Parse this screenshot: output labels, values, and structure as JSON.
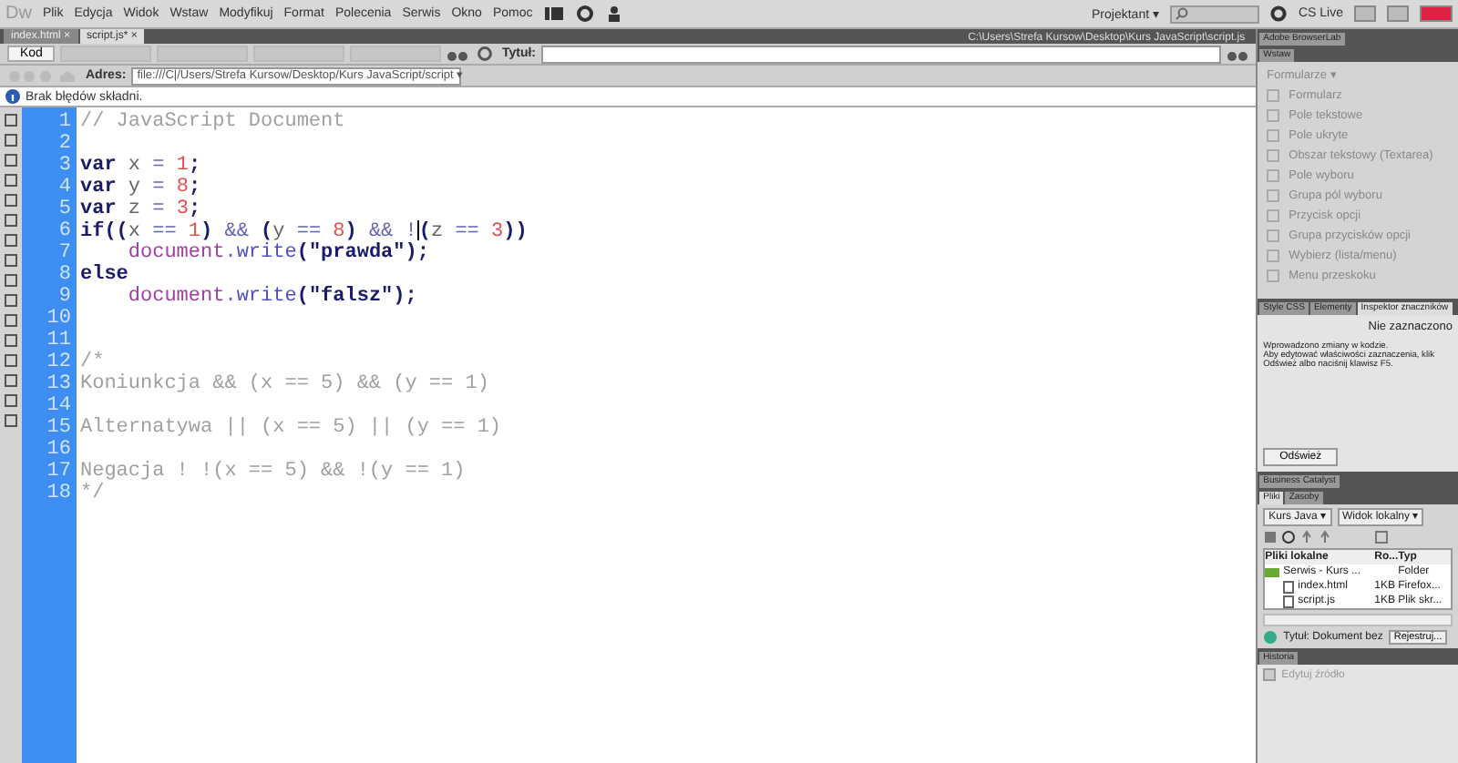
{
  "menu_bar": {
    "logo": "Dw",
    "items": [
      "Plik",
      "Edycja",
      "Widok",
      "Wstaw",
      "Modyfikuj",
      "Format",
      "Polecenia",
      "Serwis",
      "Okno",
      "Pomoc"
    ],
    "workspace": "Projektant ▾",
    "cs_live": "CS Live"
  },
  "document_tabs": [
    {
      "label": "index.html",
      "close": "×",
      "selected": false
    },
    {
      "label": "script.js*",
      "close": "×",
      "selected": true
    }
  ],
  "document_path": "C:\\Users\\Strefa Kursow\\Desktop\\Kurs JavaScript\\script.js",
  "toolbar": {
    "view_buttons": [
      {
        "label": "Kod",
        "selected": true
      }
    ],
    "title_label": "Tytuł:"
  },
  "address_bar": {
    "label": "Adres:",
    "value": "file:///C|/Users/Strefa Kursow/Desktop/Kurs JavaScript/script",
    "arrow": "▾"
  },
  "info_bar": {
    "message": "Brak błędów składni."
  },
  "editor": {
    "lines": [
      {
        "number": "1",
        "tokens": [
          {
            "kind": "comment",
            "text": "// JavaScript Document"
          }
        ]
      },
      {
        "number": "2"
      },
      {
        "number": "3",
        "tokens": [
          {
            "kind": "keyword",
            "text": "var"
          },
          {
            "kind": "ident",
            "text": " x "
          },
          {
            "kind": "op",
            "text": "="
          },
          {
            "kind": "number",
            "text": " 1"
          },
          {
            "kind": "punct",
            "text": ";"
          }
        ]
      },
      {
        "number": "4",
        "tokens": [
          {
            "kind": "keyword",
            "text": "var"
          },
          {
            "kind": "ident",
            "text": " y "
          },
          {
            "kind": "op",
            "text": "="
          },
          {
            "kind": "number",
            "text": " 8"
          },
          {
            "kind": "punct",
            "text": ";"
          }
        ]
      },
      {
        "number": "5",
        "tokens": [
          {
            "kind": "keyword",
            "text": "var"
          },
          {
            "kind": "ident",
            "text": " z "
          },
          {
            "kind": "op",
            "text": "="
          },
          {
            "kind": "number",
            "text": " 3"
          },
          {
            "kind": "punct",
            "text": ";"
          }
        ]
      },
      {
        "number": "6",
        "tokens": [
          {
            "kind": "keyword",
            "text": "if"
          },
          {
            "kind": "punct",
            "text": "(("
          },
          {
            "kind": "ident",
            "text": "x "
          },
          {
            "kind": "op",
            "text": "=="
          },
          {
            "kind": "number",
            "text": " 1"
          },
          {
            "kind": "punct",
            "text": ")"
          },
          {
            "kind": "op",
            "text": " && "
          },
          {
            "kind": "punct",
            "text": "("
          },
          {
            "kind": "ident",
            "text": "y "
          },
          {
            "kind": "op",
            "text": "=="
          },
          {
            "kind": "number",
            "text": " 8"
          },
          {
            "kind": "punct",
            "text": ")"
          },
          {
            "kind": "op",
            "text": " && !"
          },
          {
            "kind": "caret"
          },
          {
            "kind": "punct",
            "text": "("
          },
          {
            "kind": "ident",
            "text": "z "
          },
          {
            "kind": "op",
            "text": "=="
          },
          {
            "kind": "number",
            "text": " 3"
          },
          {
            "kind": "punct",
            "text": "))"
          }
        ]
      },
      {
        "number": "7",
        "tokens": [
          {
            "kind": "object",
            "text": "    document"
          },
          {
            "kind": "op",
            "text": "."
          },
          {
            "kind": "method",
            "text": "write"
          },
          {
            "kind": "punct",
            "text": "("
          },
          {
            "kind": "string",
            "text": "\"prawda\""
          },
          {
            "kind": "punct",
            "text": ");"
          }
        ]
      },
      {
        "number": "8",
        "tokens": [
          {
            "kind": "keyword",
            "text": "else"
          }
        ]
      },
      {
        "number": "9",
        "tokens": [
          {
            "kind": "object",
            "text": "    document"
          },
          {
            "kind": "op",
            "text": "."
          },
          {
            "kind": "method",
            "text": "write"
          },
          {
            "kind": "punct",
            "text": "("
          },
          {
            "kind": "string",
            "text": "\"falsz\""
          },
          {
            "kind": "punct",
            "text": ");"
          }
        ]
      },
      {
        "number": "10"
      },
      {
        "number": "11"
      },
      {
        "number": "12",
        "tokens": [
          {
            "kind": "comment",
            "text": "/*"
          }
        ]
      },
      {
        "number": "13",
        "tokens": [
          {
            "kind": "comment",
            "text": "Koniunkcja && (x == 5) && (y == 1)"
          }
        ]
      },
      {
        "number": "14"
      },
      {
        "number": "15",
        "tokens": [
          {
            "kind": "comment",
            "text": "Alternatywa || (x == 5) || (y == 1)"
          }
        ]
      },
      {
        "number": "16"
      },
      {
        "number": "17",
        "tokens": [
          {
            "kind": "comment",
            "text": "Negacja ! !(x == 5) && !(y == 1)"
          }
        ]
      },
      {
        "number": "18",
        "tokens": [
          {
            "kind": "comment",
            "text": "*/"
          }
        ]
      }
    ]
  },
  "panels": {
    "browserlab": {
      "title": "Adobe BrowserLab"
    },
    "insert": {
      "tab": "Wstaw",
      "category": "Formularze",
      "category_arrow": "▾",
      "items": [
        "Formularz",
        "Pole tekstowe",
        "Pole ukryte",
        "Obszar tekstowy (Textarea)",
        "Pole wyboru",
        "Grupa pól wyboru",
        "Przycisk opcji",
        "Grupa przycisków opcji",
        "Wybierz (lista/menu)",
        "Menu przeskoku"
      ]
    },
    "inspector": {
      "tabs": [
        {
          "label": "Style CSS",
          "selected": false
        },
        {
          "label": "Elementy",
          "selected": false
        },
        {
          "label": "Inspektor znaczników",
          "selected": true
        }
      ],
      "status": "Nie zaznaczono",
      "message": [
        "Wprowadzono zmiany w kodzie.",
        "Aby edytować właściwości zaznaczenia, klik",
        "Odśwież albo naciśnij klawisz F5."
      ],
      "button": "Odśwież"
    },
    "business_catalyst": {
      "title": "Business Catalyst"
    },
    "files": {
      "tabs": [
        {
          "label": "Pliki",
          "selected": true
        },
        {
          "label": "Zasoby",
          "selected": false
        }
      ],
      "site": "Kurs Java",
      "view": "Widok lokalny",
      "dropdown_arrow": "▾",
      "columns": [
        "Pliki lokalne",
        "Ro...",
        "Typ"
      ],
      "rows": [
        {
          "name": "Serwis - Kurs ...",
          "type": "Folder",
          "kind": "folder"
        },
        {
          "name": "index.html",
          "size": "1KB",
          "type": "Firefox...",
          "kind": "file"
        },
        {
          "name": "script.js",
          "size": "1KB",
          "type": "Plik skr...",
          "kind": "file"
        }
      ],
      "status": "Tytuł: Dokument bez",
      "button": "Rejestruj..."
    },
    "history": {
      "title": "Historia",
      "items": [
        "Edytuj źródło"
      ]
    }
  }
}
